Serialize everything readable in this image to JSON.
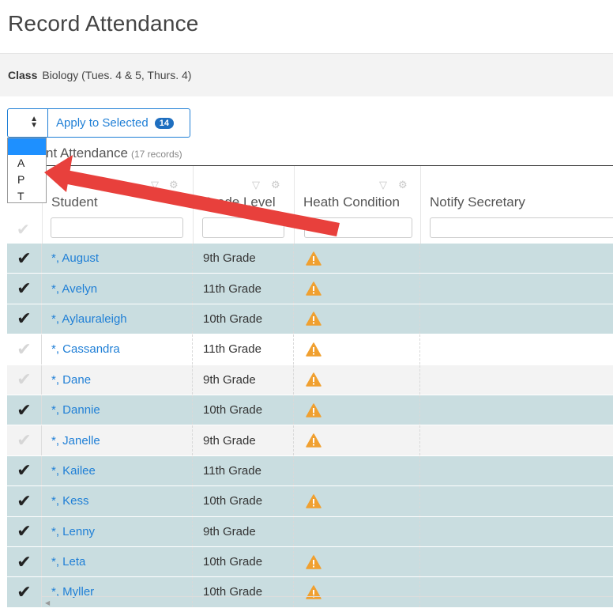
{
  "page": {
    "title": "Record Attendance"
  },
  "class_bar": {
    "label": "Class",
    "value": "Biology (Tues. 4 & 5, Thurs. 4)"
  },
  "toolbar": {
    "select_value": "",
    "apply_label": "Apply to Selected",
    "selected_count": "14"
  },
  "dropdown": {
    "options": [
      "",
      "A",
      "P",
      "T"
    ]
  },
  "section": {
    "title": "nt Attendance",
    "records": "(17 records)"
  },
  "columns": {
    "student": "Student",
    "grade": "Grade Level",
    "health": "Heath Condition",
    "notify": "Notify Secretary"
  },
  "rows": [
    {
      "checked": true,
      "name": "*, August",
      "grade": "9th Grade",
      "warning": true
    },
    {
      "checked": true,
      "name": "*, Avelyn",
      "grade": "11th Grade",
      "warning": true
    },
    {
      "checked": true,
      "name": "*, Aylauraleigh",
      "grade": "10th Grade",
      "warning": true
    },
    {
      "checked": false,
      "name": "*, Cassandra",
      "grade": "11th Grade",
      "warning": true
    },
    {
      "checked": false,
      "name": "*, Dane",
      "grade": "9th Grade",
      "warning": true
    },
    {
      "checked": true,
      "name": "*, Dannie",
      "grade": "10th Grade",
      "warning": true
    },
    {
      "checked": false,
      "name": "*, Janelle",
      "grade": "9th Grade",
      "warning": true
    },
    {
      "checked": true,
      "name": "*, Kailee",
      "grade": "11th Grade",
      "warning": false
    },
    {
      "checked": true,
      "name": "*, Kess",
      "grade": "10th Grade",
      "warning": true
    },
    {
      "checked": true,
      "name": "*, Lenny",
      "grade": "9th Grade",
      "warning": false
    },
    {
      "checked": true,
      "name": "*, Leta",
      "grade": "10th Grade",
      "warning": true
    },
    {
      "checked": true,
      "name": "*, Myller",
      "grade": "10th Grade",
      "warning": true
    }
  ],
  "icons": {
    "check": "check-icon",
    "warning": "warning-icon",
    "filter": "filter-icon",
    "gear": "gear-icon",
    "select_arrows": "up-down-arrows-icon"
  },
  "colors": {
    "accent": "#1f7fd6",
    "selected_row": "#c9dde0",
    "warning": "#f0a030",
    "annotation_arrow": "#e8403c"
  }
}
